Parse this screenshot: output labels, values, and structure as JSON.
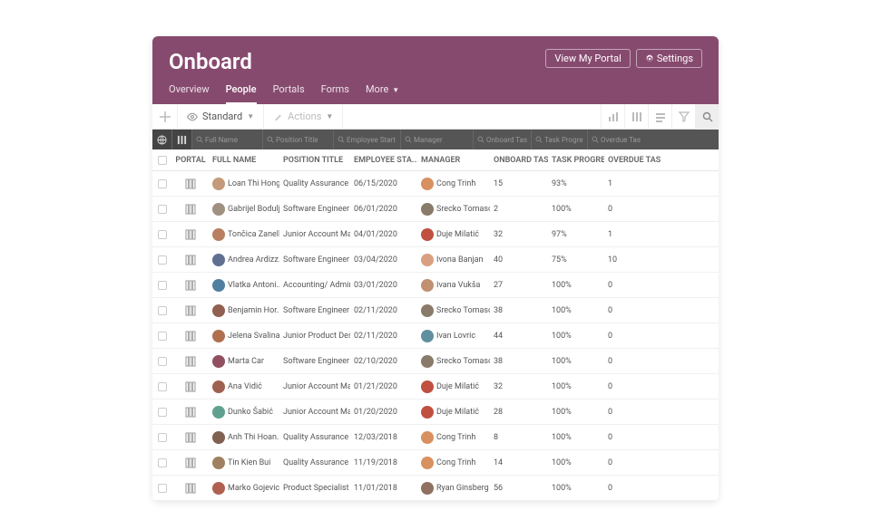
{
  "header": {
    "title": "Onboard",
    "view_portal": "View My Portal",
    "settings": "Settings"
  },
  "tabs": [
    "Overview",
    "People",
    "Portals",
    "Forms",
    "More"
  ],
  "active_tab": 1,
  "toolbar": {
    "view_dropdown": "Standard",
    "actions": "Actions"
  },
  "filters": {
    "full_name": "Full Name",
    "position": "Position Title",
    "start": "Employee Start D",
    "manager": "Manager",
    "onboard": "Onboard Tasks",
    "progress": "Task Progress",
    "overdue": "Overdue Tasks"
  },
  "columns": {
    "portal": "PORTAL",
    "full_name": "FULL NAME",
    "position": "POSITION TITLE",
    "start": "EMPLOYEE STA...",
    "manager": "MANAGER",
    "tasks": "ONBOARD TASKS",
    "progress": "TASK PROGRESS",
    "overdue": "OVERDUE TASKS"
  },
  "rows": [
    {
      "name": "Loan Thi Hong...",
      "pos": "Quality Assurance ...",
      "date": "06/15/2020",
      "mgr": "Cong Trinh",
      "tasks": "15",
      "prog": "93%",
      "over": "1",
      "a1": "#c49a7a",
      "a2": "#d89060"
    },
    {
      "name": "Gabrijel Bodulj...",
      "pos": "Software Engineer I...",
      "date": "06/01/2020",
      "mgr": "Srecko Tomaso...",
      "tasks": "2",
      "prog": "100%",
      "over": "0",
      "a1": "#a09080",
      "a2": "#8a7a6a"
    },
    {
      "name": "Tončica Zanella",
      "pos": "Junior Account Ma...",
      "date": "04/01/2020",
      "mgr": "Duje Milatić",
      "tasks": "32",
      "prog": "97%",
      "over": "1",
      "a1": "#b88060",
      "a2": "#c05040"
    },
    {
      "name": "Andrea Ardizz...",
      "pos": "Software Engineer I...",
      "date": "03/04/2020",
      "mgr": "Ivona Banjan",
      "tasks": "40",
      "prog": "75%",
      "over": "10",
      "a1": "#607090",
      "a2": "#d8a080"
    },
    {
      "name": "Vlatka Antoni...",
      "pos": "Accounting/ Admin...",
      "date": "03/01/2020",
      "mgr": "Ivana Vukša",
      "tasks": "27",
      "prog": "100%",
      "over": "0",
      "a1": "#5080a0",
      "a2": "#c09070"
    },
    {
      "name": "Benjamin Hor...",
      "pos": "Software Engineer I...",
      "date": "02/11/2020",
      "mgr": "Srecko Tomaso...",
      "tasks": "38",
      "prog": "100%",
      "over": "0",
      "a1": "#906050",
      "a2": "#8a7a6a"
    },
    {
      "name": "Jelena Svalina",
      "pos": "Junior Product Desi...",
      "date": "02/11/2020",
      "mgr": "Ivan Lovric",
      "tasks": "44",
      "prog": "100%",
      "over": "0",
      "a1": "#b07050",
      "a2": "#6090a0"
    },
    {
      "name": "Marta Car",
      "pos": "Software Engineer I...",
      "date": "02/10/2020",
      "mgr": "Srecko Tomaso...",
      "tasks": "38",
      "prog": "100%",
      "over": "0",
      "a1": "#905060",
      "a2": "#8a7a6a"
    },
    {
      "name": "Ana Vidić",
      "pos": "Junior Account Ma...",
      "date": "01/21/2020",
      "mgr": "Duje Milatić",
      "tasks": "32",
      "prog": "100%",
      "over": "0",
      "a1": "#a06050",
      "a2": "#c05040"
    },
    {
      "name": "Dunko Šabić",
      "pos": "Junior Account Ma...",
      "date": "01/20/2020",
      "mgr": "Duje Milatić",
      "tasks": "28",
      "prog": "100%",
      "over": "0",
      "a1": "#60a090",
      "a2": "#c05040"
    },
    {
      "name": "Anh Thi Hoan...",
      "pos": "Quality Assurance ...",
      "date": "12/03/2018",
      "mgr": "Cong Trinh",
      "tasks": "8",
      "prog": "100%",
      "over": "0",
      "a1": "#806050",
      "a2": "#d89060"
    },
    {
      "name": "Tin Kien Bui",
      "pos": "Quality Assurance ...",
      "date": "11/19/2018",
      "mgr": "Cong Trinh",
      "tasks": "14",
      "prog": "100%",
      "over": "0",
      "a1": "#a08060",
      "a2": "#d89060"
    },
    {
      "name": "Marko Gojevic",
      "pos": "Product Specialist",
      "date": "11/01/2018",
      "mgr": "Ryan Ginsberg",
      "tasks": "56",
      "prog": "100%",
      "over": "0",
      "a1": "#b06050",
      "a2": "#907060"
    }
  ]
}
